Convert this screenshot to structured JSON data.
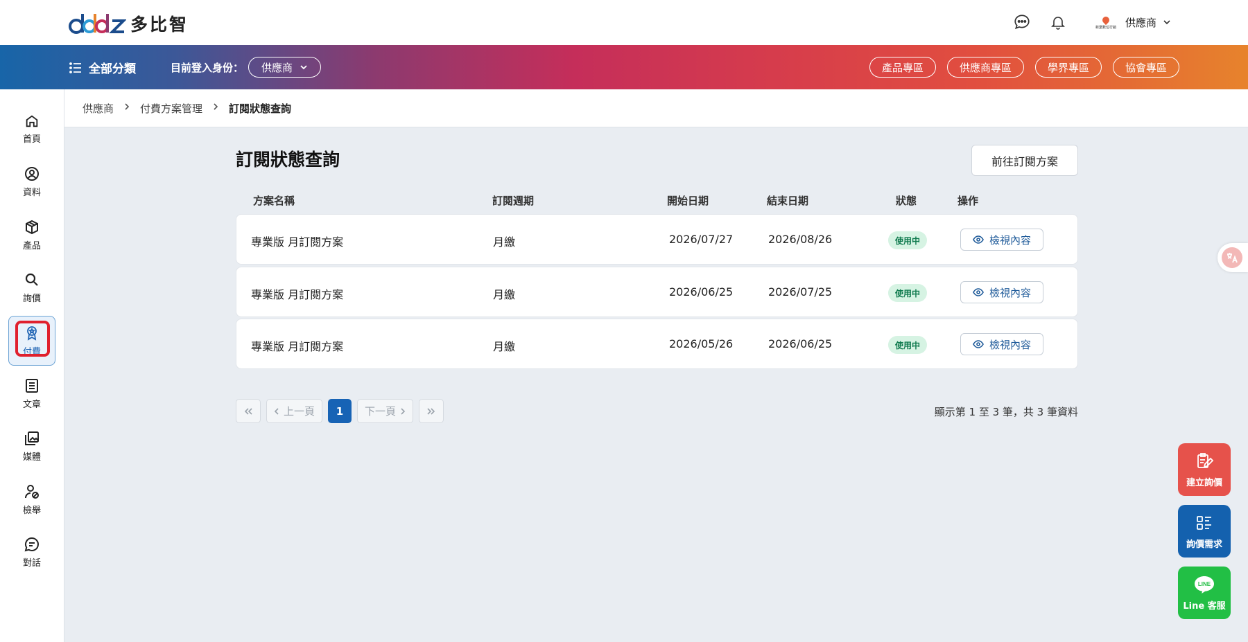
{
  "brand": {
    "logo_text": "多比智"
  },
  "header": {
    "user_name": "供應商",
    "user_logo_text": "新業數位行銷"
  },
  "navbar": {
    "all_categories": "全部分類",
    "role_label": "目前登入身份：",
    "role_value": "供應商",
    "zones": [
      "產品專區",
      "供應商專區",
      "學界專區",
      "協會專區"
    ]
  },
  "sidebar": {
    "items": [
      {
        "label": "首頁",
        "icon": "home-icon"
      },
      {
        "label": "資料",
        "icon": "user-circle-icon"
      },
      {
        "label": "產品",
        "icon": "box-icon"
      },
      {
        "label": "詢價",
        "icon": "search-icon"
      },
      {
        "label": "付費",
        "icon": "award-badge-icon",
        "active": true
      },
      {
        "label": "文章",
        "icon": "document-icon"
      },
      {
        "label": "媒體",
        "icon": "media-gallery-icon"
      },
      {
        "label": "檢舉",
        "icon": "user-block-icon"
      },
      {
        "label": "對話",
        "icon": "chat-icon"
      }
    ]
  },
  "breadcrumb": [
    "供應商",
    "付費方案管理",
    "訂閱狀態查詢"
  ],
  "page": {
    "title": "訂閱狀態查詢",
    "go_button": "前往訂閱方案"
  },
  "table": {
    "headers": [
      "方案名稱",
      "訂閱週期",
      "開始日期",
      "結束日期",
      "狀態",
      "操作"
    ],
    "rows": [
      {
        "name": "專業版 月訂閱方案",
        "cycle": "月繳",
        "start": "2026/07/27",
        "end": "2026/08/26",
        "status": "使用中",
        "action": "檢視內容"
      },
      {
        "name": "專業版 月訂閱方案",
        "cycle": "月繳",
        "start": "2026/06/25",
        "end": "2026/07/25",
        "status": "使用中",
        "action": "檢視內容"
      },
      {
        "name": "專業版 月訂閱方案",
        "cycle": "月繳",
        "start": "2026/05/26",
        "end": "2026/06/25",
        "status": "使用中",
        "action": "檢視內容"
      }
    ]
  },
  "pagination": {
    "prev": "上一頁",
    "next": "下一頁",
    "current_page": "1",
    "info": "顯示第 1 至 3 筆，共 3 筆資料"
  },
  "fabs": {
    "create_inquiry": "建立詢價",
    "inquiry_needs": "詢價需求",
    "line_service": "Line 客服",
    "line_logo": "LINE"
  },
  "colors": {
    "accent": "#1763b5",
    "status_active_bg": "#d6f3e3",
    "status_active_text": "#0f7a4e",
    "fab_red": "#e6524b",
    "fab_blue": "#1461ae",
    "fab_green": "#22bf45"
  }
}
